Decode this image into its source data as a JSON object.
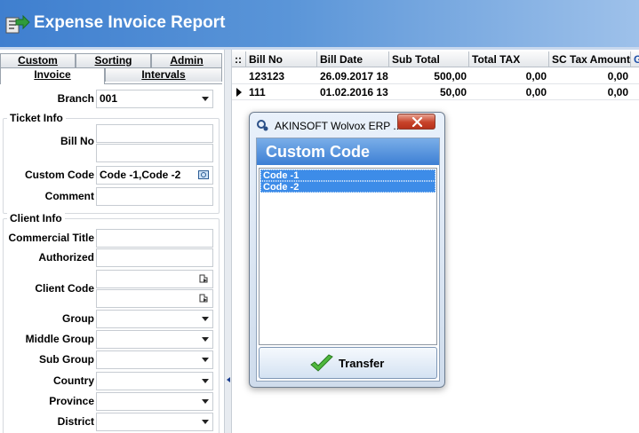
{
  "header": {
    "title": "Expense Invoice Report"
  },
  "tabs": {
    "row1": [
      {
        "label": "Custom"
      },
      {
        "label": "Sorting"
      },
      {
        "label": "Admin"
      }
    ],
    "row2": [
      {
        "label": "Invoice",
        "active": true
      },
      {
        "label": "Intervals"
      }
    ]
  },
  "form": {
    "branch_label": "Branch",
    "branch_value": "001",
    "ticket_group": "Ticket Info",
    "bill_no_label": "Bill No",
    "custom_code_label": "Custom Code",
    "custom_code_value": "Code -1,Code -2",
    "comment_label": "Comment",
    "client_group": "Client Info",
    "commercial_title_label": "Commercial Title",
    "authorized_label": "Authorized",
    "client_code_label": "Client Code",
    "group_label": "Group",
    "middle_group_label": "Middle Group",
    "sub_group_label": "Sub Group",
    "country_label": "Country",
    "province_label": "Province",
    "district_label": "District"
  },
  "grid": {
    "headers": [
      "Bill No",
      "Bill Date",
      "Sub Total",
      "Total TAX",
      "SC Tax Amount",
      "G"
    ],
    "rows": [
      {
        "bill_no": "123123",
        "bill_date": "26.09.2017 18",
        "sub_total": "500,00",
        "total_tax": "0,00",
        "sc_tax": "0,00"
      },
      {
        "bill_no": "111",
        "bill_date": "01.02.2016 13",
        "sub_total": "50,00",
        "total_tax": "0,00",
        "sc_tax": "0,00"
      }
    ]
  },
  "dialog": {
    "title": "AKINSOFT Wolvox ERP ...",
    "heading": "Custom Code",
    "items": [
      "Code -1",
      "Code -2"
    ],
    "transfer_label": "Transfer"
  },
  "colors": {
    "header_blue": "#3f7fcf",
    "selection_blue": "#3d8ce8",
    "close_red": "#c8432a"
  }
}
